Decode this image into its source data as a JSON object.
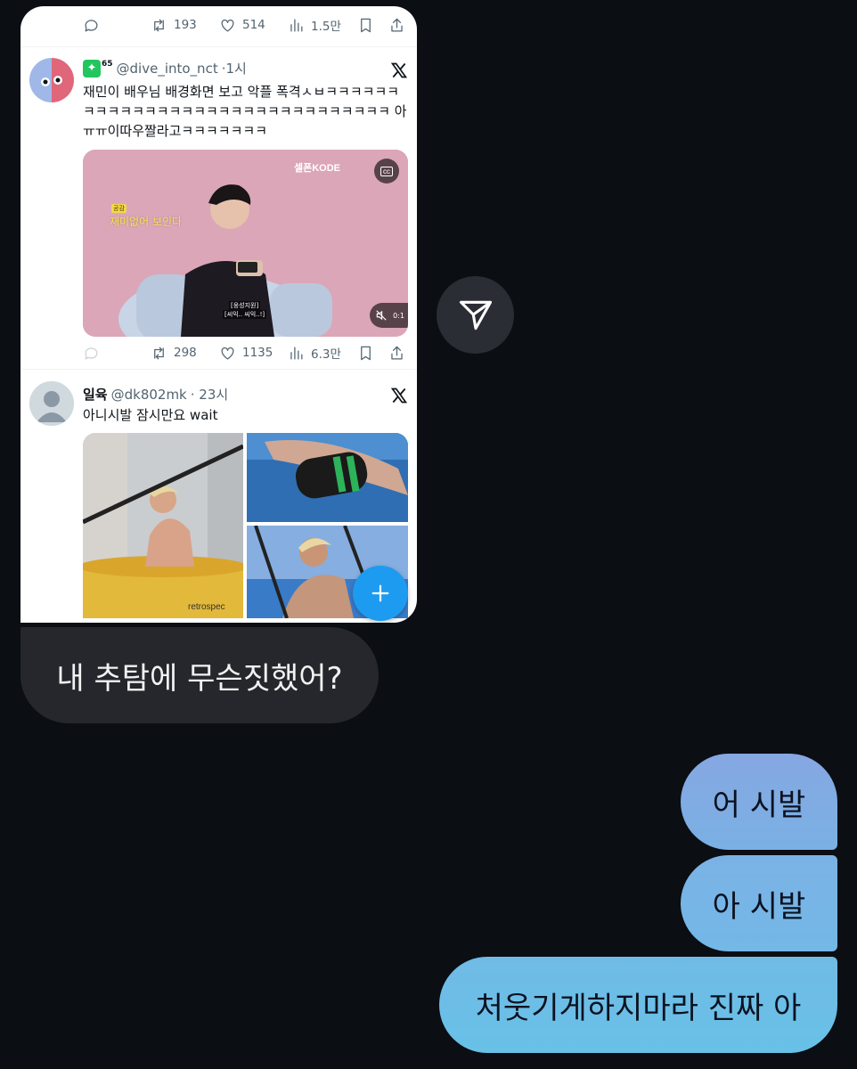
{
  "shared_post_view": {
    "top_actions": {
      "retweets": "193",
      "likes": "514",
      "views": "1.5만"
    },
    "tweet1": {
      "badge_number": "65",
      "handle": "@dive_into_nct",
      "time": "·1시",
      "text": "재민이 배우님 배경화면 보고 악플 폭격ㅅㅂㅋㅋㅋㅋㅋㅋㅋㅋㅋㅋㅋㅋㅋㅋㅋㅋㅋㅋㅋㅋㅋㅋㅋㅋㅋㅋㅋㅋㅋㅋㅋ 아ㅠㅠ이따우짤라고ㅋㅋㅋㅋㅋㅋㅋ",
      "video": {
        "brand": "셀폰KODE",
        "caption_tag": "공감",
        "caption": "재미없어 보인다",
        "subtitle_top": "[웅성지원]",
        "subtitle_bottom": "[씨익.. 씨익..!]",
        "duration_fragment": "0:1"
      },
      "actions": {
        "retweets": "298",
        "likes": "1135",
        "views": "6.3만"
      }
    },
    "tweet2": {
      "name": "일육",
      "handle": "@dk802mk",
      "time": "· 23시",
      "text": "아니시발 잠시만요 wait",
      "photo_caption": "retrospec"
    }
  },
  "messages": [
    {
      "side": "received",
      "text": "내 추탐에 무슨짓했어?"
    },
    {
      "side": "sent",
      "text": "어 시발"
    },
    {
      "side": "sent",
      "text": "아 시발"
    },
    {
      "side": "sent",
      "text": "처웃기게하지마라 진짜 아"
    }
  ],
  "colors": {
    "background": "#0b0e13",
    "received_bubble": "#25272c",
    "sent_gradient_top": "#7fa6e3",
    "sent_gradient_bottom": "#6cbfe6",
    "twitter_blue": "#1d9bf0"
  },
  "icons": [
    "reply-icon",
    "retweet-icon",
    "like-icon",
    "views-icon",
    "bookmark-icon",
    "share-icon",
    "x-logo-icon",
    "add-post-icon",
    "send-icon",
    "mute-icon",
    "cc-icon"
  ]
}
